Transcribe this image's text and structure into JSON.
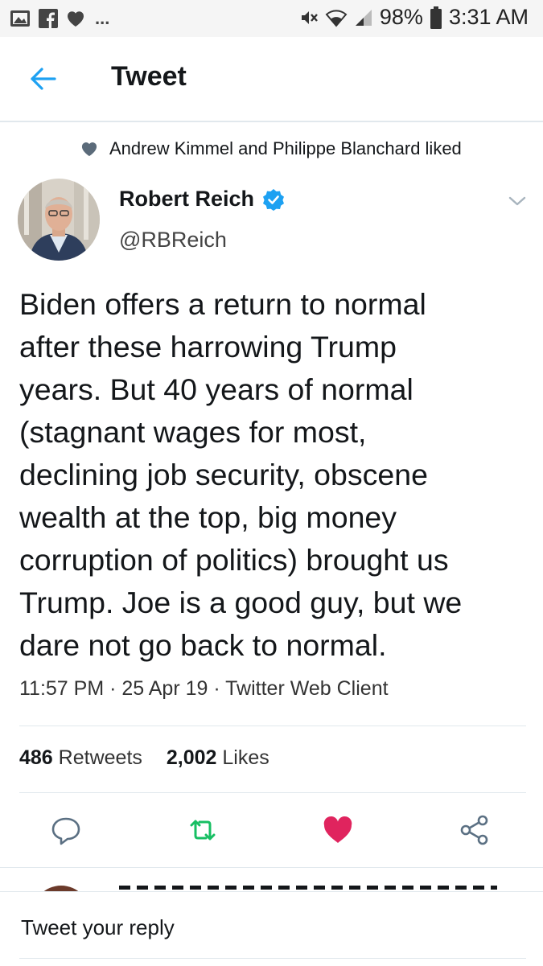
{
  "status_bar": {
    "notification_icons": [
      "image-icon",
      "facebook-icon",
      "heart-icon"
    ],
    "ellipsis": "...",
    "battery": "98%",
    "time": "3:31 AM"
  },
  "header": {
    "title": "Tweet"
  },
  "social_context": {
    "text": "Andrew Kimmel and Philippe Blanchard liked"
  },
  "tweet": {
    "author_name": "Robert Reich",
    "author_handle": "@RBReich",
    "verified": true,
    "text_lines": [
      "Biden offers a return to normal",
      "after these harrowing Trump",
      "years. But 40 years of normal",
      "(stagnant wages for most,",
      "declining job security, obscene",
      "wealth at the top, big money",
      "corruption of politics) brought us",
      "Trump. Joe is a good guy, but we",
      "dare not go back to normal."
    ],
    "meta": "11:57 PM · 25 Apr 19 · Twitter Web Client",
    "retweets_count": "486",
    "retweets_label": "Retweets",
    "likes_count": "2,002",
    "likes_label": "Likes",
    "liked": true
  },
  "colors": {
    "accent": "#1da1f2",
    "retweet": "#17bf63",
    "like": "#e0245e",
    "text": "#14171a"
  },
  "reply": {
    "placeholder": "Tweet your reply"
  }
}
